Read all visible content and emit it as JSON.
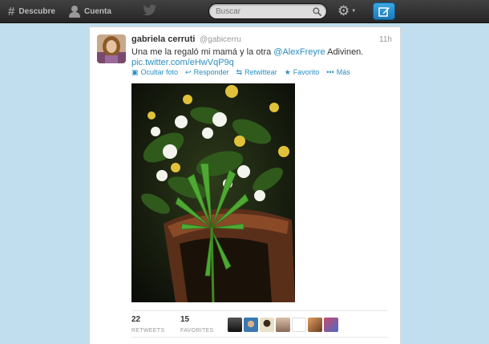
{
  "topbar": {
    "discover_icon": "hash-icon",
    "discover_label": "Descubre",
    "account_icon": "person-icon",
    "account_label": "Cuenta",
    "brand_icon": "twitter-bird-icon",
    "search": {
      "placeholder": "Buscar",
      "value": "",
      "icon": "search-icon"
    },
    "settings_icon": "gear-icon",
    "compose_icon": "compose-icon",
    "colors": {
      "bar": "#2f2f2f",
      "compose": "#2a8ec0"
    }
  },
  "tweet": {
    "fullname": "gabriela cerruti",
    "username": "@gabicerru",
    "time": "11h",
    "text_before": "Una me la regaló mi mamá y la otra ",
    "mention": "@AlexFreyre",
    "text_after": " Adivinen.",
    "link": "pic.twitter.com/eHwVqP9q",
    "actions": [
      {
        "icon": "photo-icon",
        "label": "Ocultar foto"
      },
      {
        "icon": "reply-icon",
        "label": "Responder"
      },
      {
        "icon": "retweet-icon",
        "label": "Retwittear"
      },
      {
        "icon": "star-icon",
        "label": "Favorito"
      },
      {
        "icon": "more-icon",
        "label": "Más"
      }
    ],
    "photo_icon": "plant-photo",
    "stats": {
      "retweets_count": "22",
      "retweets_label": "RETWEETS",
      "favorites_count": "15",
      "favorites_label": "FAVORITES"
    },
    "favoriter_avatars": 8,
    "link_color": "#2a8ec0"
  }
}
